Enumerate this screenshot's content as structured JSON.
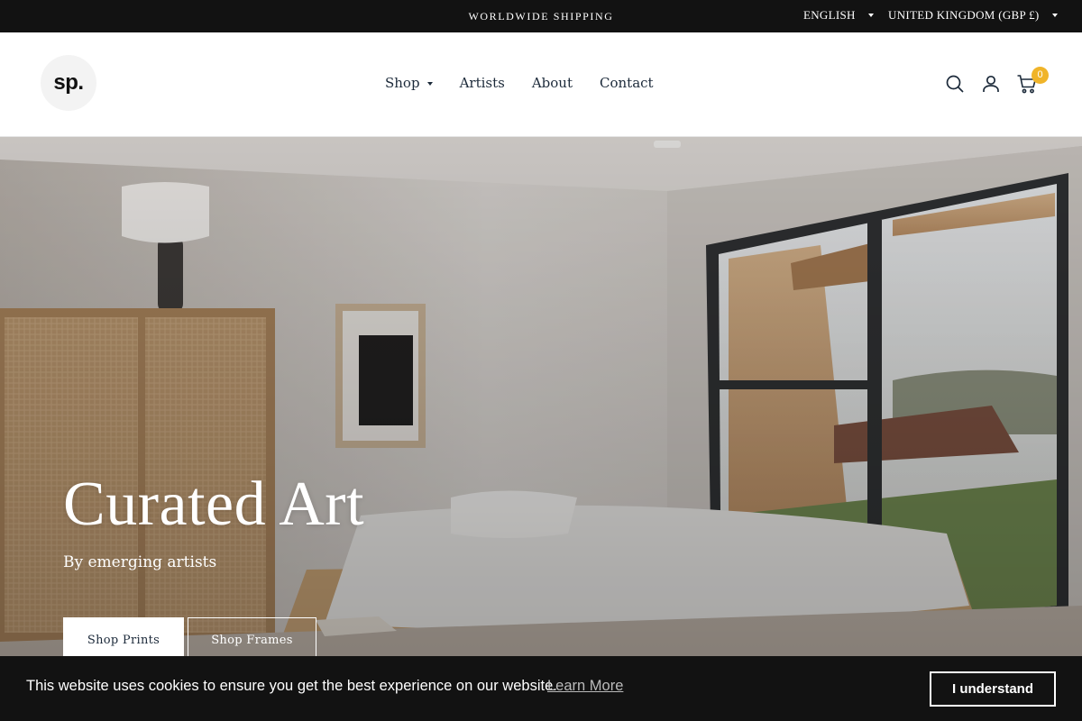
{
  "topbar": {
    "shipping": "WORLDWIDE SHIPPING",
    "language": "ENGLISH",
    "country": "UNITED KINGDOM (GBP £)"
  },
  "header": {
    "logo": "sp.",
    "nav": [
      "Shop",
      "Artists",
      "About",
      "Contact"
    ],
    "cart_count": "0",
    "icons": [
      "search-icon",
      "account-icon",
      "cart-icon"
    ]
  },
  "hero": {
    "title": "Curated Art",
    "subtitle": "By emerging artists",
    "buttons": [
      "Shop Prints",
      "Shop Frames"
    ]
  },
  "cookie": {
    "message": "This website uses cookies to ensure you get the best experience on our website.",
    "learn_more": "Learn More",
    "accept": "I understand"
  },
  "colors": {
    "dark_bar": "#121212",
    "nav_text": "#1c2a3a",
    "badge": "#f0b429"
  }
}
